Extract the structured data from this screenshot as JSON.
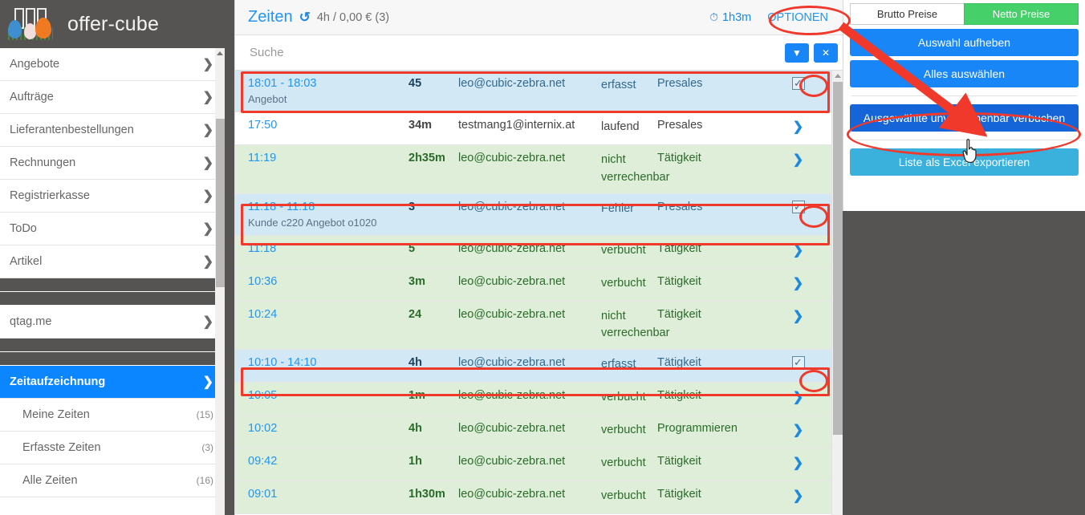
{
  "brand": {
    "title": "offer-cube",
    "logo_icon": "easter-eggs-cube-logo"
  },
  "sidebar": {
    "items": [
      {
        "label": "Angebote"
      },
      {
        "label": "Aufträge"
      },
      {
        "label": "Lieferantenbestellungen"
      },
      {
        "label": "Rechnungen"
      },
      {
        "label": "Registrierkasse"
      },
      {
        "label": "ToDo"
      },
      {
        "label": "Artikel"
      }
    ],
    "qtag": {
      "label": "qtag.me"
    },
    "active": {
      "label": "Zeitaufzeichnung"
    },
    "subitems": [
      {
        "label": "Meine Zeiten",
        "count": "(15)"
      },
      {
        "label": "Erfasste Zeiten",
        "count": "(3)"
      },
      {
        "label": "Alle Zeiten",
        "count": "(16)"
      }
    ],
    "chevron_icon": "chevron-right-icon"
  },
  "main": {
    "title": "Zeiten",
    "refresh_icon": "refresh-icon",
    "summary": "4h / 0,00 € (3)",
    "duration": "1h3m",
    "clock_icon": "clock-icon",
    "options_label": "OPTIONEN",
    "search": {
      "placeholder": "Suche",
      "value": ""
    },
    "filter_icon": "filter-icon",
    "clear_icon": "close-x-icon",
    "rows": [
      {
        "time": "18:01 - 18:03",
        "duration": "45",
        "user": "leo@cubic-zebra.net",
        "state": "erfasst",
        "type": "Presales",
        "sub": "Angebot",
        "style": "selected",
        "action": "checkbox-checked"
      },
      {
        "time": "17:50",
        "duration": "34m",
        "user": "testmang1@internix.at",
        "state": "laufend",
        "type": "Presales",
        "sub": "",
        "style": "white",
        "action": "chevron-right"
      },
      {
        "time": "11:19",
        "duration": "2h35m",
        "user": "leo@cubic-zebra.net",
        "state": "nicht verrechenbar",
        "type": "Tätigkeit",
        "sub": "",
        "style": "green",
        "action": "chevron-right"
      },
      {
        "time": "11:18 - 11:18",
        "duration": "3",
        "user": "leo@cubic-zebra.net",
        "state": "Fehler",
        "type": "Presales",
        "sub": "Kunde c220 Angebot o1020",
        "style": "selected",
        "action": "checkbox-checked"
      },
      {
        "time": "11:18",
        "duration": "5",
        "user": "leo@cubic-zebra.net",
        "state": "verbucht",
        "type": "Tätigkeit",
        "sub": "",
        "style": "green",
        "action": "chevron-right"
      },
      {
        "time": "10:36",
        "duration": "3m",
        "user": "leo@cubic-zebra.net",
        "state": "verbucht",
        "type": "Tätigkeit",
        "sub": "",
        "style": "green",
        "action": "chevron-right"
      },
      {
        "time": "10:24",
        "duration": "24",
        "user": "leo@cubic-zebra.net",
        "state": "nicht verrechenbar",
        "type": "Tätigkeit",
        "sub": "",
        "style": "green",
        "action": "chevron-right"
      },
      {
        "time": "10:10 - 14:10",
        "duration": "4h",
        "user": "leo@cubic-zebra.net",
        "state": "erfasst",
        "type": "Tätigkeit",
        "sub": "",
        "style": "selected",
        "action": "checkbox-checked"
      },
      {
        "time": "10:05",
        "duration": "1m",
        "user": "leo@cubic-zebra.net",
        "state": "verbucht",
        "type": "Tätigkeit",
        "sub": "",
        "style": "green",
        "action": "chevron-right"
      },
      {
        "time": "10:02",
        "duration": "4h",
        "user": "leo@cubic-zebra.net",
        "state": "verbucht",
        "type": "Programmieren",
        "sub": "",
        "style": "green",
        "action": "chevron-right"
      },
      {
        "time": "09:42",
        "duration": "1h",
        "user": "leo@cubic-zebra.net",
        "state": "verbucht",
        "type": "Tätigkeit",
        "sub": "",
        "style": "green",
        "action": "chevron-right"
      },
      {
        "time": "09:01",
        "duration": "1h30m",
        "user": "leo@cubic-zebra.net",
        "state": "verbucht",
        "type": "Tätigkeit",
        "sub": "",
        "style": "green",
        "action": "chevron-right"
      }
    ]
  },
  "right_panel": {
    "price_toggle": {
      "gross_label": "Brutto Preise",
      "net_label": "Netto Preise",
      "selected": "Netto Preise"
    },
    "deselect_label": "Auswahl aufheben",
    "select_all_label": "Alles auswählen",
    "book_unbillable_label": "Ausgewählte unverrechenbar verbuchen",
    "export_label": "Liste als Excel exportieren"
  },
  "colors": {
    "accent_blue": "#1886f7",
    "link_blue": "#2196f3",
    "dark_blue": "#1565d8",
    "light_blue": "#3ab0dd",
    "green": "#45d06a",
    "annotation_red": "#f0392b",
    "row_green": "#deeed8",
    "row_selected": "#d3e8f5",
    "sidebar_dark": "#555453"
  },
  "annotations": {
    "highlight_icon": "red-ellipse-highlight",
    "arrow_icon": "red-arrow-pointer",
    "cursor_icon": "pointing-hand-cursor"
  }
}
